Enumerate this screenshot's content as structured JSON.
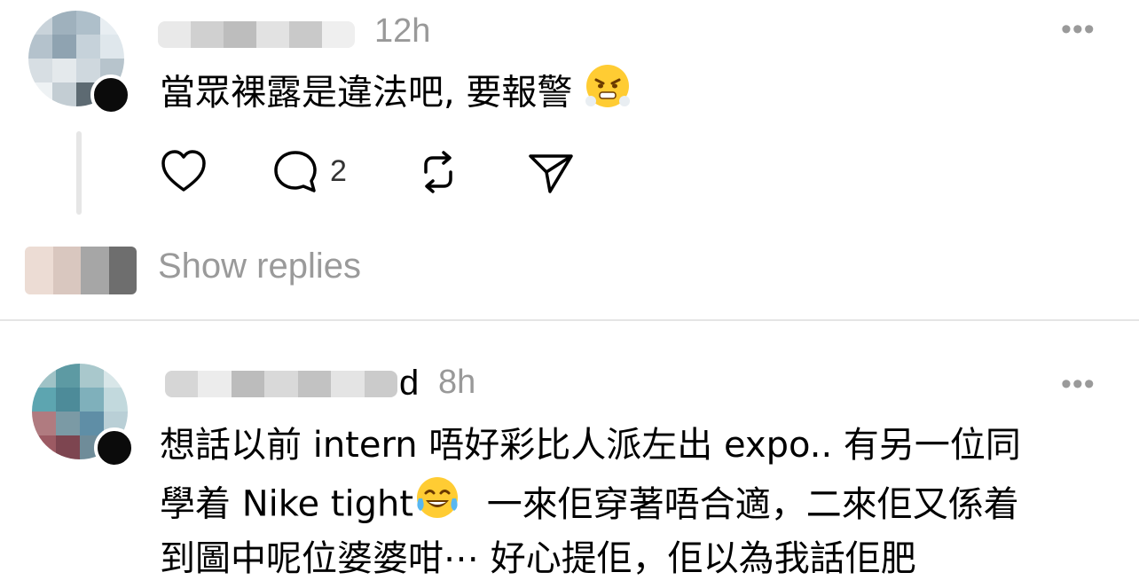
{
  "posts": [
    {
      "time": "12h",
      "text": "當眾裸露是違法吧, 要報警",
      "emoji": "angry-huffing-face",
      "replies_count": "2",
      "show_replies_label": "Show replies"
    },
    {
      "username_visible": "d",
      "time": "8h",
      "lines": [
        "想話以前 intern 唔好彩比人派左出 expo.. 有另一位同",
        "學着 Nike tight",
        "一來佢穿著唔合適，二來佢又係着",
        "到圖中呢位婆婆咁⋯ 好心提佢，佢以為我話佢肥"
      ],
      "emoji": "tears-of-joy-face"
    }
  ],
  "more_label": "•••",
  "colors": {
    "muted": "#999999",
    "divider": "#e5e5e5"
  }
}
